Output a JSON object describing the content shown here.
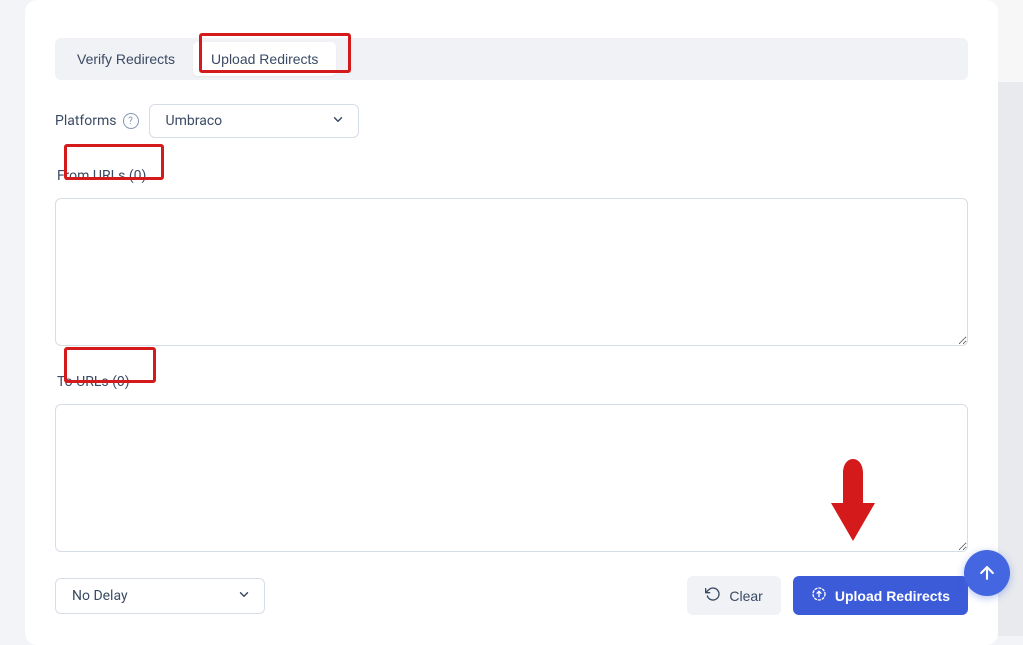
{
  "tabs": {
    "verify": "Verify Redirects",
    "upload": "Upload Redirects",
    "active": "upload"
  },
  "platforms": {
    "label": "Platforms",
    "selected": "Umbraco"
  },
  "from_urls": {
    "label": "From URLs (0)",
    "value": ""
  },
  "to_urls": {
    "label": "To URLs (0)",
    "value": ""
  },
  "delay": {
    "selected": "No Delay"
  },
  "buttons": {
    "clear": "Clear",
    "upload": "Upload Redirects"
  },
  "annotations": {
    "highlight_upload_tab": true,
    "highlight_from_label": true,
    "highlight_to_label": true,
    "arrow_to_upload_button": true
  },
  "colors": {
    "primary": "#3c5bd9",
    "annotation_red": "#d41a1a",
    "text": "#3a4a63"
  }
}
